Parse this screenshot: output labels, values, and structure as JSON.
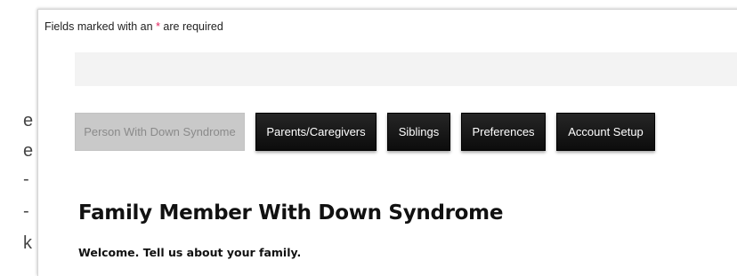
{
  "page": {
    "left_strip_chars": [
      "e",
      "e",
      "-",
      "-",
      "k"
    ]
  },
  "form": {
    "required_note_prefix": "Fields marked with an ",
    "required_star": "*",
    "required_note_suffix": " are required",
    "tabs": [
      {
        "label": "Person With Down Syndrome",
        "active": true
      },
      {
        "label": "Parents/Caregivers",
        "active": false
      },
      {
        "label": "Siblings",
        "active": false
      },
      {
        "label": "Preferences",
        "active": false
      },
      {
        "label": "Account Setup",
        "active": false
      }
    ],
    "section_title": "Family Member With Down Syndrome",
    "welcome_text": "Welcome. Tell us about your family."
  },
  "colors": {
    "required_star": "#e0245e",
    "tab_dark": "#111111",
    "tab_active_bg": "#c9c9c9",
    "tab_active_text": "#8a8a8a"
  }
}
